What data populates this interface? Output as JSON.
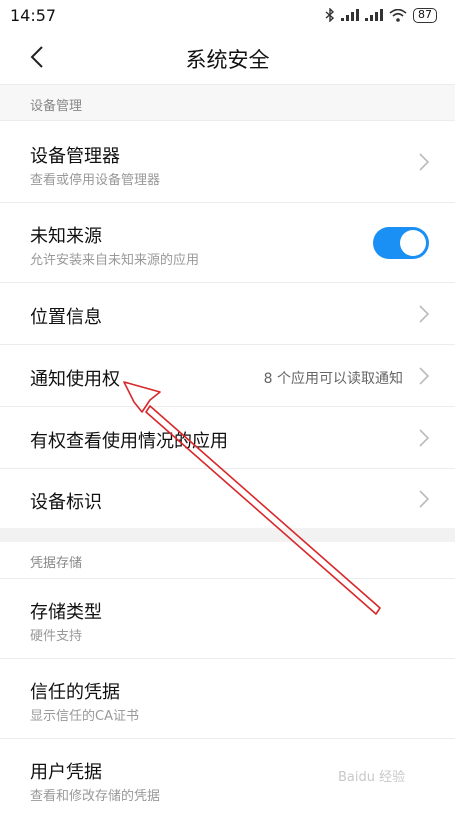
{
  "status": {
    "time": "14:57",
    "battery": "87"
  },
  "header": {
    "title": "系统安全"
  },
  "sections": [
    {
      "title": "设备管理"
    },
    {
      "title": "凭据存储"
    }
  ],
  "rows": [
    {
      "label": "设备管理器",
      "sub": "查看或停用设备管理器"
    },
    {
      "label": "未知来源",
      "sub": "允许安装来自未知来源的应用",
      "toggle": true
    },
    {
      "label": "位置信息"
    },
    {
      "label": "通知使用权",
      "value": "8 个应用可以读取通知"
    },
    {
      "label": "有权查看使用情况的应用"
    },
    {
      "label": "设备标识"
    },
    {
      "label": "存储类型",
      "sub": "硬件支持"
    },
    {
      "label": "信任的凭据",
      "sub": "显示信任的CA证书"
    },
    {
      "label": "用户凭据",
      "sub": "查看和修改存储的凭据"
    }
  ],
  "annotation": {
    "arrow_color": "#d9282a"
  },
  "watermark": "Baidu 经验"
}
